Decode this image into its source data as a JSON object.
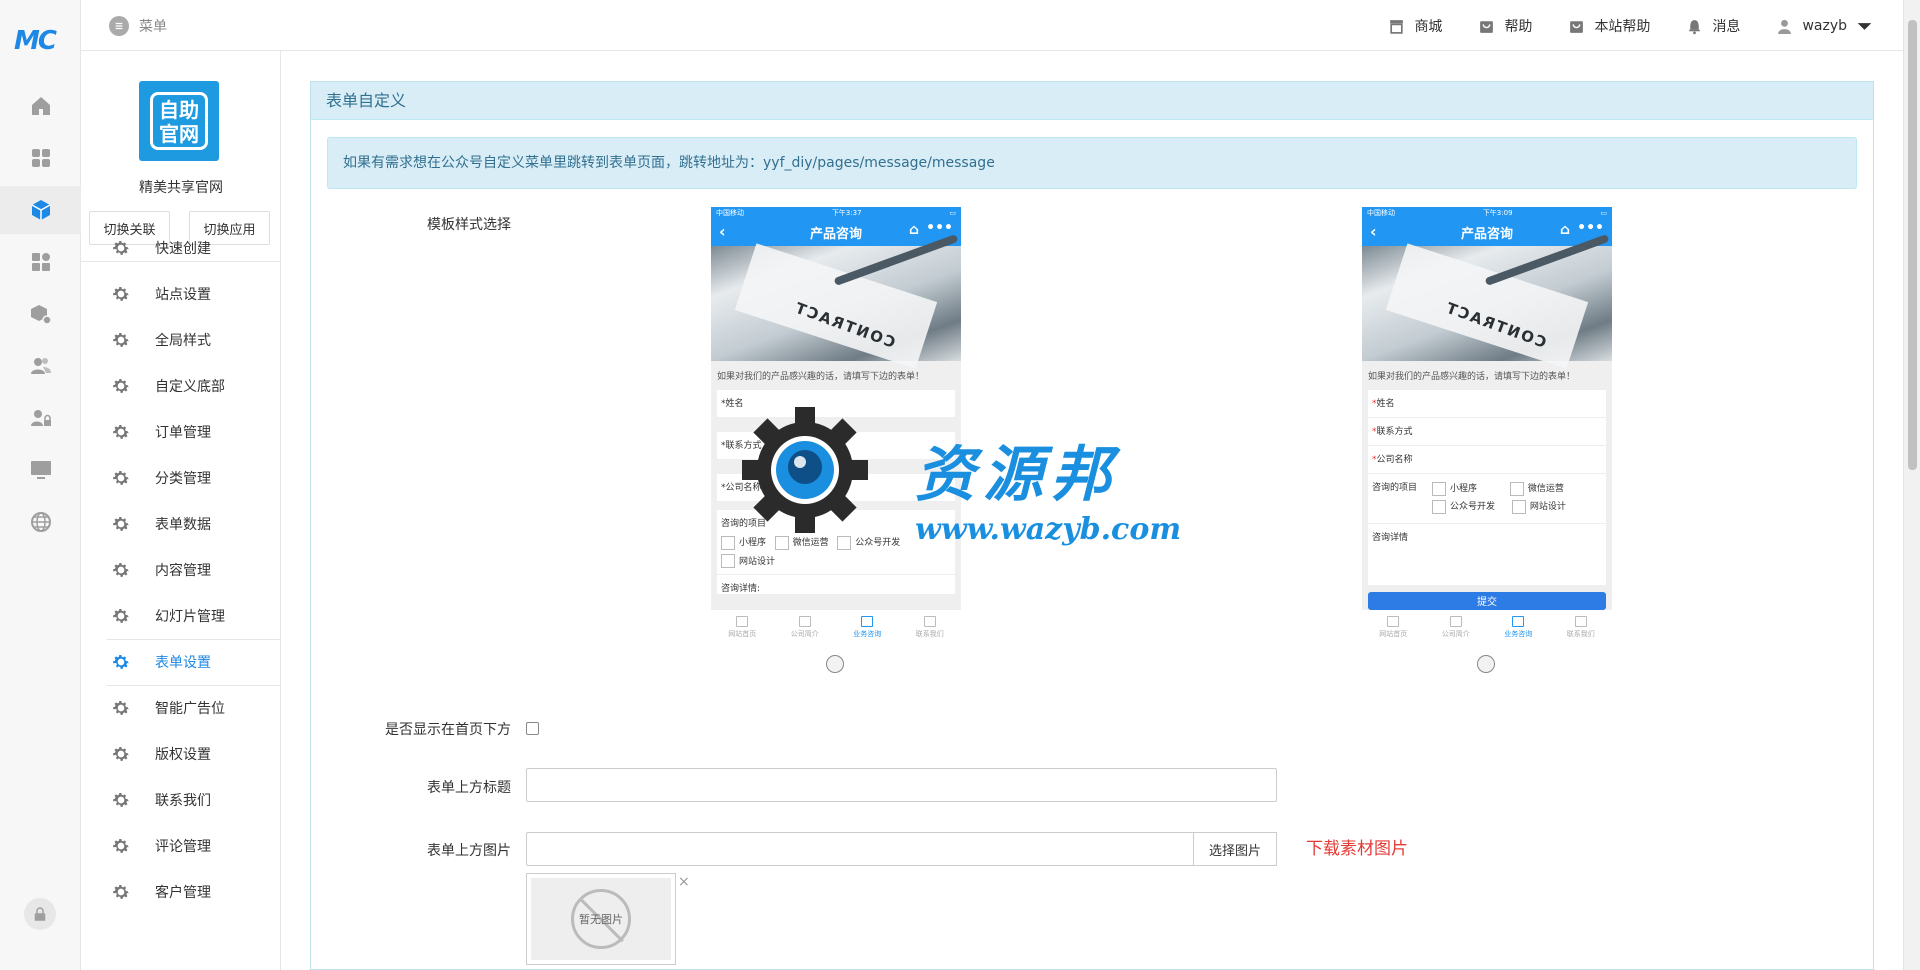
{
  "app": {
    "logo_text": "MC"
  },
  "topbar": {
    "menu_label": "菜单",
    "links": [
      {
        "label": "商城",
        "icon": "store-icon"
      },
      {
        "label": "帮助",
        "icon": "help-bag-icon"
      },
      {
        "label": "本站帮助",
        "icon": "site-help-icon"
      },
      {
        "label": "消息",
        "icon": "bell-icon"
      },
      {
        "label": "wazyb",
        "icon": "user-icon"
      }
    ]
  },
  "rail": {
    "items": [
      "home-icon",
      "apps-grid-icon",
      "cube-icon",
      "widgets-icon",
      "package-gear-icon",
      "users-icon",
      "user-lock-icon",
      "monitor-icon",
      "globe-icon"
    ],
    "active_index": 2
  },
  "sidebar": {
    "logo_text": "自助官网",
    "site_name": "精美共享官网",
    "switch_link": "切换关联",
    "switch_app": "切换应用",
    "items": [
      {
        "label": "快速创建"
      },
      {
        "label": "站点设置"
      },
      {
        "label": "全局样式"
      },
      {
        "label": "自定义底部"
      },
      {
        "label": "订单管理"
      },
      {
        "label": "分类管理"
      },
      {
        "label": "表单数据"
      },
      {
        "label": "内容管理"
      },
      {
        "label": "幻灯片管理"
      },
      {
        "label": "表单设置"
      },
      {
        "label": "智能广告位"
      },
      {
        "label": "版权设置"
      },
      {
        "label": "联系我们"
      },
      {
        "label": "评论管理"
      },
      {
        "label": "客户管理"
      }
    ],
    "active_index": 9
  },
  "panel": {
    "title": "表单自定义",
    "alert": "如果有需求想在公众号自定义菜单里跳转到表单页面，跳转地址为：yyf_diy/pages/message/message"
  },
  "form": {
    "template_label": "模板样式选择",
    "show_home_label": "是否显示在首页下方",
    "show_home_checked": false,
    "top_title_label": "表单上方标题",
    "top_title_value": "",
    "top_image_label": "表单上方图片",
    "top_image_value": "",
    "choose_image": "选择图片",
    "download_link": "下载素材图片",
    "no_image": "暂无图片",
    "close_mark": "×"
  },
  "phone_common": {
    "carrier": "中国移动",
    "nav_title": "产品咨询",
    "banner_word": "CONTRACT",
    "intro": "如果对我们的产品感兴趣的话，请填写下边的表单！",
    "tabs": [
      "网站首页",
      "公司简介",
      "业务咨询",
      "联系我们"
    ],
    "active_tab": 2
  },
  "phone1": {
    "time": "下午3:37",
    "fields": [
      "*姓名",
      "*联系方式",
      "*公司名称"
    ],
    "project_label": "咨询的项目",
    "options": [
      "小程序",
      "微信运营",
      "公众号开发",
      "网站设计"
    ],
    "detail_label": "咨询详情:"
  },
  "phone2": {
    "time": "下午3:09",
    "fields": [
      "姓名",
      "联系方式",
      "公司名称"
    ],
    "project_label": "咨询的项目",
    "options": [
      "小程序",
      "微信运营",
      "公众号开发",
      "网站设计"
    ],
    "detail_label": "咨询详情",
    "submit": "提交"
  },
  "watermark": {
    "title": "资源邦",
    "url": "www.wazyb.com"
  },
  "colors": {
    "primary": "#1e88e5",
    "alert_bg": "#d9edf7",
    "alert_text": "#31708f",
    "danger": "#e53935"
  }
}
